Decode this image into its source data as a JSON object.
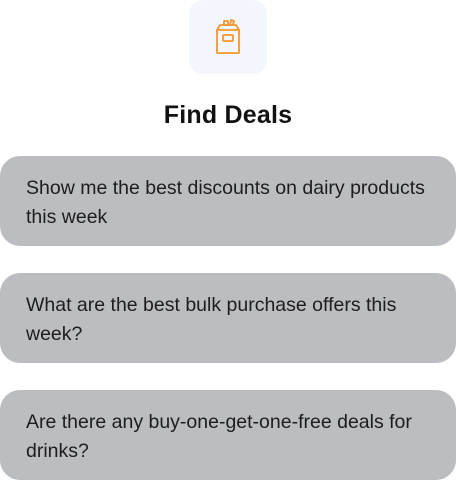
{
  "header": {
    "icon": "shopping-bag-icon",
    "title": "Find Deals"
  },
  "colors": {
    "icon_accent": "#f5962d",
    "icon_tile_bg": "#f3f6fc",
    "suggestion_bg": "#bcbdc1"
  },
  "suggestions": [
    {
      "text": "Show me the best discounts on dairy products this week"
    },
    {
      "text": "What are the best bulk purchase offers this week?"
    },
    {
      "text": "Are there any buy-one-get-one-free deals for drinks?"
    }
  ]
}
